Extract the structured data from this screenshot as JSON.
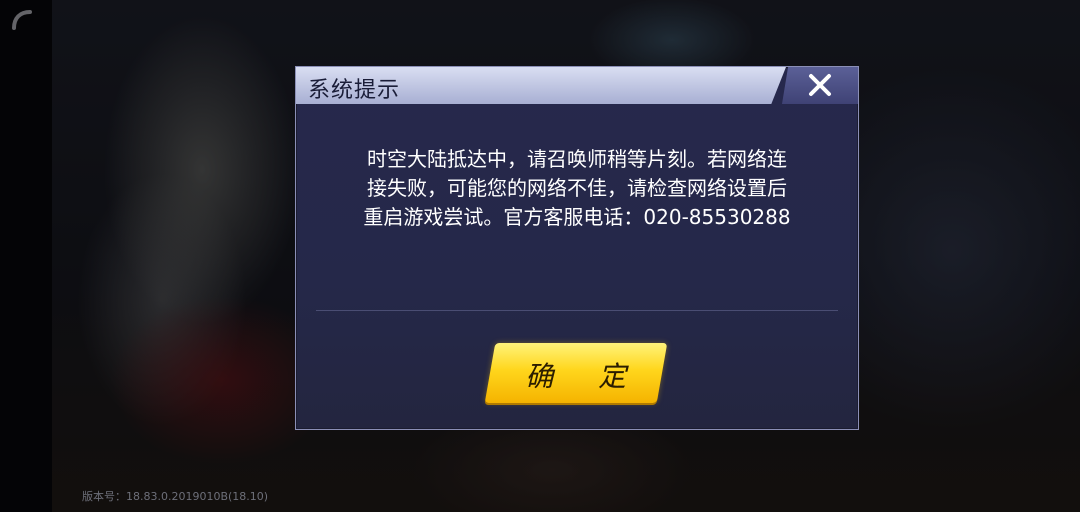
{
  "dialog": {
    "title": "系统提示",
    "message": "时空大陆抵达中，请召唤师稍等片刻。若网络连\n接失败，可能您的网络不佳，请检查网络设置后\n重启游戏尝试。官方客服电话：020-85530288",
    "ok_label": "确 定",
    "close_icon": "close-icon"
  },
  "footer": {
    "version": "版本号：18.83.0.2019010B(18.10)"
  },
  "colors": {
    "dialog_bg": "#26284c",
    "title_bar": "#c8cde8",
    "button_yellow": "#ffd61c",
    "text": "#ffffff"
  }
}
